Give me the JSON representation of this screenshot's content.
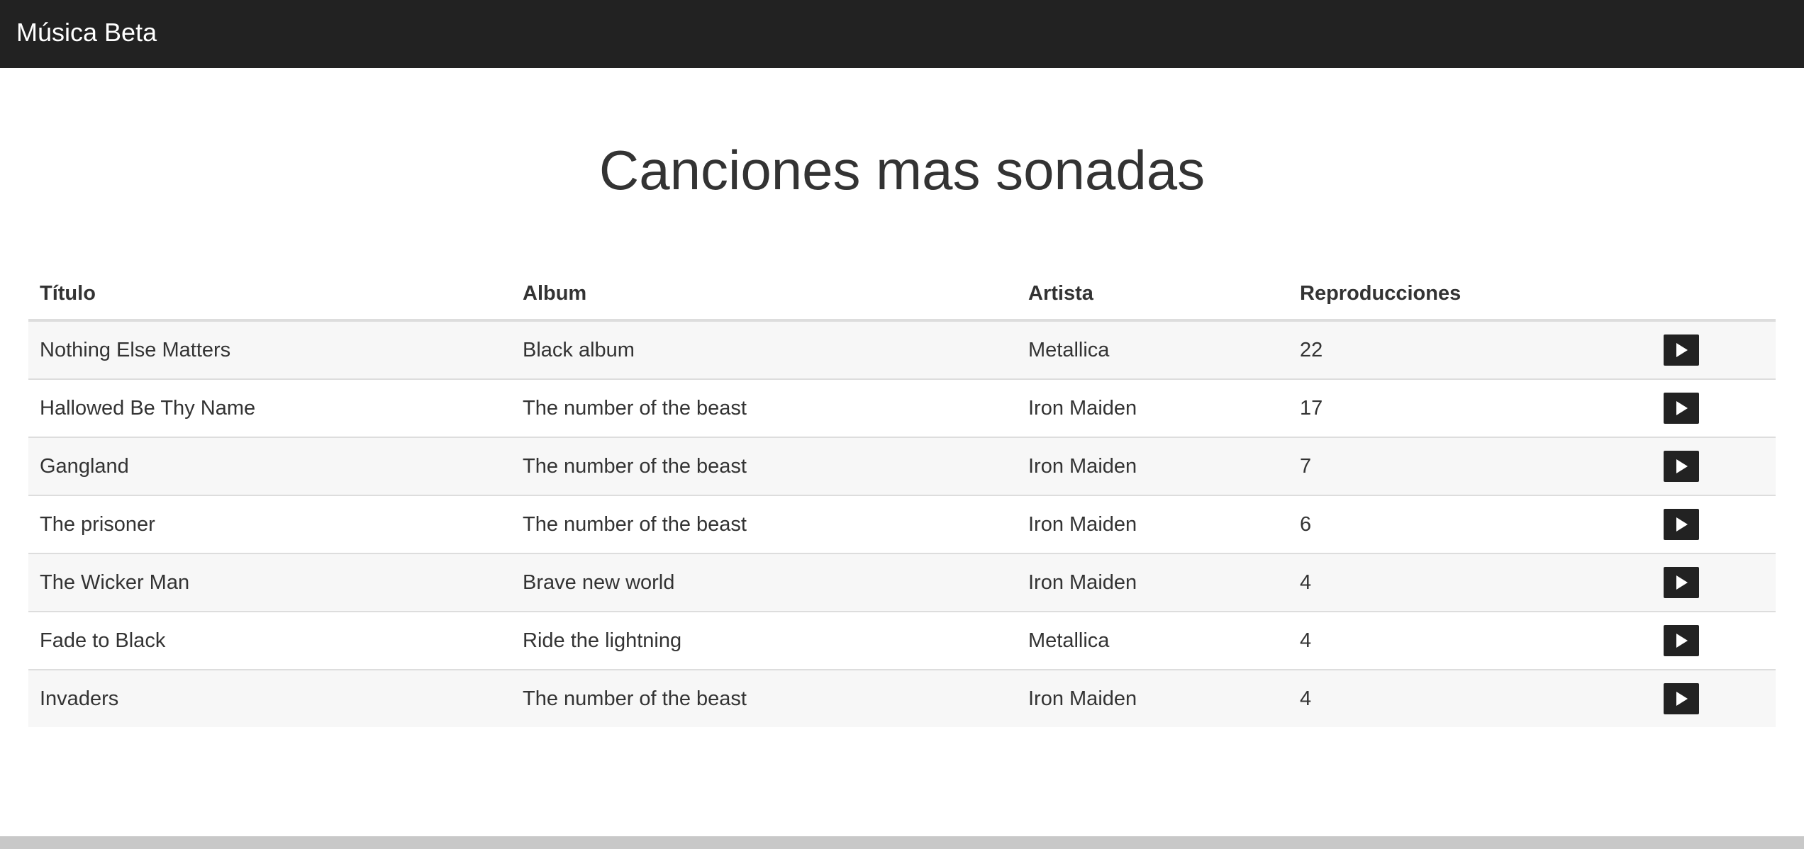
{
  "navbar": {
    "brand": "Música Beta"
  },
  "page": {
    "title": "Canciones mas sonadas"
  },
  "table": {
    "headers": [
      "Título",
      "Album",
      "Artista",
      "Reproducciones",
      ""
    ],
    "rows": [
      {
        "title": "Nothing Else Matters",
        "album": "Black album",
        "artist": "Metallica",
        "plays": "22"
      },
      {
        "title": "Hallowed Be Thy Name",
        "album": "The number of the beast",
        "artist": "Iron Maiden",
        "plays": "17"
      },
      {
        "title": "Gangland",
        "album": "The number of the beast",
        "artist": "Iron Maiden",
        "plays": "7"
      },
      {
        "title": "The prisoner",
        "album": "The number of the beast",
        "artist": "Iron Maiden",
        "plays": "6"
      },
      {
        "title": "The Wicker Man",
        "album": "Brave new world",
        "artist": "Iron Maiden",
        "plays": "4"
      },
      {
        "title": "Fade to Black",
        "album": "Ride the lightning",
        "artist": "Metallica",
        "plays": "4"
      },
      {
        "title": "Invaders",
        "album": "The number of the beast",
        "artist": "Iron Maiden",
        "plays": "4"
      }
    ],
    "action_icon": "play-icon"
  },
  "colors": {
    "navbar": "#222222",
    "row_stripe": "#f7f7f7",
    "border": "#dddddd",
    "footer": "#c8c8c8"
  }
}
